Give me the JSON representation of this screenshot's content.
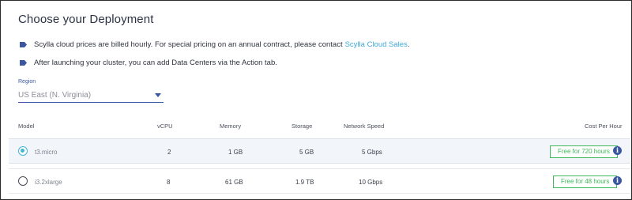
{
  "title": "Choose your Deployment",
  "colors": {
    "accent": "#3a57a0",
    "link": "#3fa9d8",
    "radio_selected": "#43b6d6",
    "badge": "#3eb85a",
    "selected_row_bg": "#f2f5fa"
  },
  "notes": [
    {
      "icon": "tag-icon",
      "text": "Scylla cloud prices are billed hourly. For special pricing on an annual contract, please contact",
      "link_text": "Scylla Cloud Sales",
      "suffix": "."
    },
    {
      "icon": "tag-icon",
      "text": "After launching your cluster, you can add Data Centers via the Action tab."
    }
  ],
  "region": {
    "label": "Region",
    "value": "US East (N. Virginia)",
    "icon": "caret-down-icon"
  },
  "table": {
    "columns": [
      "Model",
      "vCPU",
      "Memory",
      "Storage",
      "Network Speed",
      "Cost Per Hour"
    ],
    "rows": [
      {
        "selected": true,
        "model": "t3.micro",
        "vcpu": "2",
        "memory": "1 GB",
        "storage": "5 GB",
        "network": "5 Gbps",
        "cost": "Free for 720 hours",
        "info_icon": "info-icon"
      },
      {
        "selected": false,
        "model": "i3.2xlarge",
        "vcpu": "8",
        "memory": "61 GB",
        "storage": "1.9 TB",
        "network": "10 Gbps",
        "cost": "Free for 48 hours",
        "info_icon": "info-icon"
      }
    ]
  }
}
